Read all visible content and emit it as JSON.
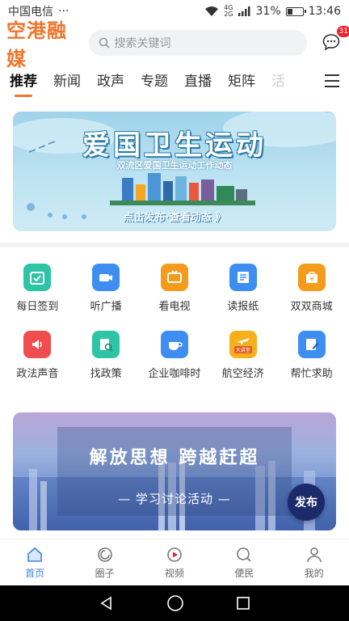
{
  "status_bar": {
    "carrier": "中国电信",
    "dots": "···",
    "network_top": "4G",
    "network_bottom": "2G",
    "battery_percent": "31%",
    "battery_level": 0.31,
    "time": "13:46"
  },
  "header": {
    "logo": "空港融媒",
    "search_placeholder": "搜索关键词",
    "message_badge": "31"
  },
  "tabs": [
    {
      "label": "推荐",
      "active": true
    },
    {
      "label": "新闻"
    },
    {
      "label": "政声"
    },
    {
      "label": "专题"
    },
    {
      "label": "直播"
    },
    {
      "label": "矩阵"
    },
    {
      "label": "活"
    }
  ],
  "banner": {
    "title": "爱国卫生运动",
    "subtitle": "双流区爱国卫生运动工作动态",
    "cta": "点击发布·查看动态 》"
  },
  "grid": [
    [
      {
        "label": "每日签到",
        "icon": "checkin-icon",
        "color": "#2ec4a6"
      },
      {
        "label": "听广播",
        "icon": "radio-icon",
        "color": "#3d8ef0"
      },
      {
        "label": "看电视",
        "icon": "tv-icon",
        "color": "#f59b1b"
      },
      {
        "label": "读报纸",
        "icon": "newspaper-icon",
        "color": "#3d8ef0"
      },
      {
        "label": "双双商城",
        "icon": "mall-icon",
        "color": "#f59b1b"
      }
    ],
    [
      {
        "label": "政法声音",
        "icon": "speaker-icon",
        "color": "#f04e4e"
      },
      {
        "label": "找政策",
        "icon": "policy-icon",
        "color": "#2ec4a6"
      },
      {
        "label": "企业咖啡时",
        "icon": "coffee-icon",
        "color": "#3d8ef0"
      },
      {
        "label": "航空经济",
        "icon": "aviation-icon",
        "color": "#f5b01b",
        "badge": "大讲堂"
      },
      {
        "label": "帮忙求助",
        "icon": "help-icon",
        "color": "#3d8ef0"
      }
    ]
  ],
  "banner2": {
    "title": "解放思想  跨越赶超",
    "subtitle": "— 学习讨论活动 —",
    "publish": "发布"
  },
  "bottom_nav": [
    {
      "label": "首页",
      "icon": "home-icon",
      "active": true
    },
    {
      "label": "圈子",
      "icon": "circle-icon"
    },
    {
      "label": "视频",
      "icon": "video-icon"
    },
    {
      "label": "便民",
      "icon": "service-icon"
    },
    {
      "label": "我的",
      "icon": "profile-icon"
    }
  ]
}
